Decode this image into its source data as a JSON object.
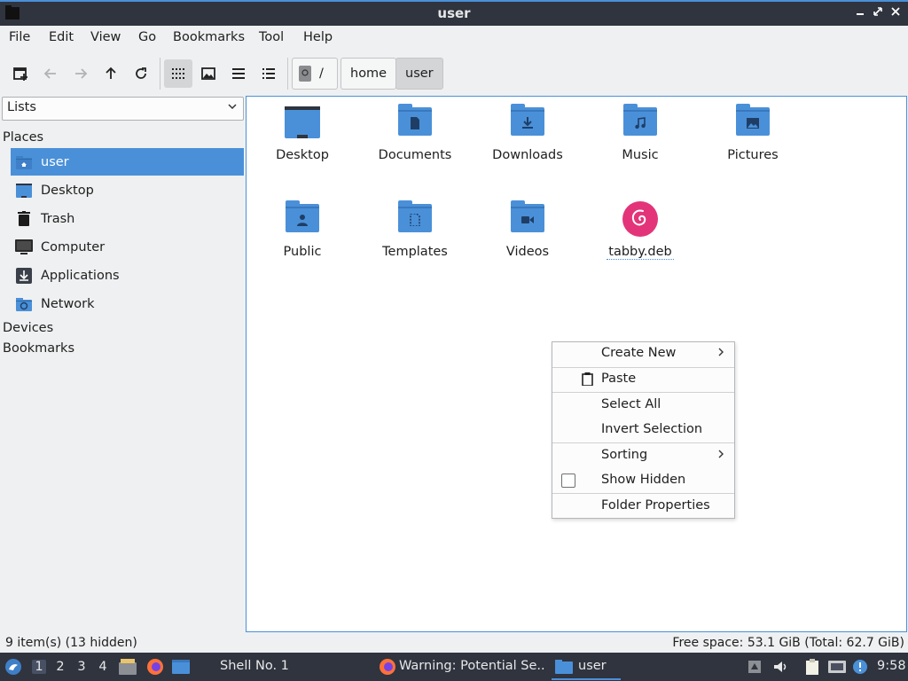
{
  "window": {
    "title": "user"
  },
  "menubar": [
    "File",
    "Edit",
    "View",
    "Go",
    "Bookmarks",
    "Tool",
    "Help"
  ],
  "breadcrumb": {
    "root": "/",
    "parts": [
      "home",
      "user"
    ]
  },
  "sidebar": {
    "selector": "Lists",
    "sections": {
      "places": "Places",
      "devices": "Devices",
      "bookmarks": "Bookmarks"
    },
    "places": [
      "user",
      "Desktop",
      "Trash",
      "Computer",
      "Applications",
      "Network"
    ]
  },
  "files": [
    "Desktop",
    "Documents",
    "Downloads",
    "Music",
    "Pictures",
    "Public",
    "Templates",
    "Videos",
    "tabby.deb"
  ],
  "context_menu": {
    "create_new": "Create New",
    "paste": "Paste",
    "select_all": "Select All",
    "invert_selection": "Invert Selection",
    "sorting": "Sorting",
    "show_hidden": "Show Hidden",
    "folder_properties": "Folder Properties"
  },
  "statusbar": {
    "left": "9 item(s) (13 hidden)",
    "right": "Free space: 53.1 GiB (Total: 62.7 GiB)"
  },
  "taskbar": {
    "workspaces": [
      "1",
      "2",
      "3",
      "4"
    ],
    "tasks": [
      "Shell No. 1",
      "Warning: Potential Se...",
      "user"
    ],
    "clock": "9:58"
  },
  "colors": {
    "accent": "#4a90d9",
    "panel": "#2f343f",
    "debian": "#e3347a"
  }
}
